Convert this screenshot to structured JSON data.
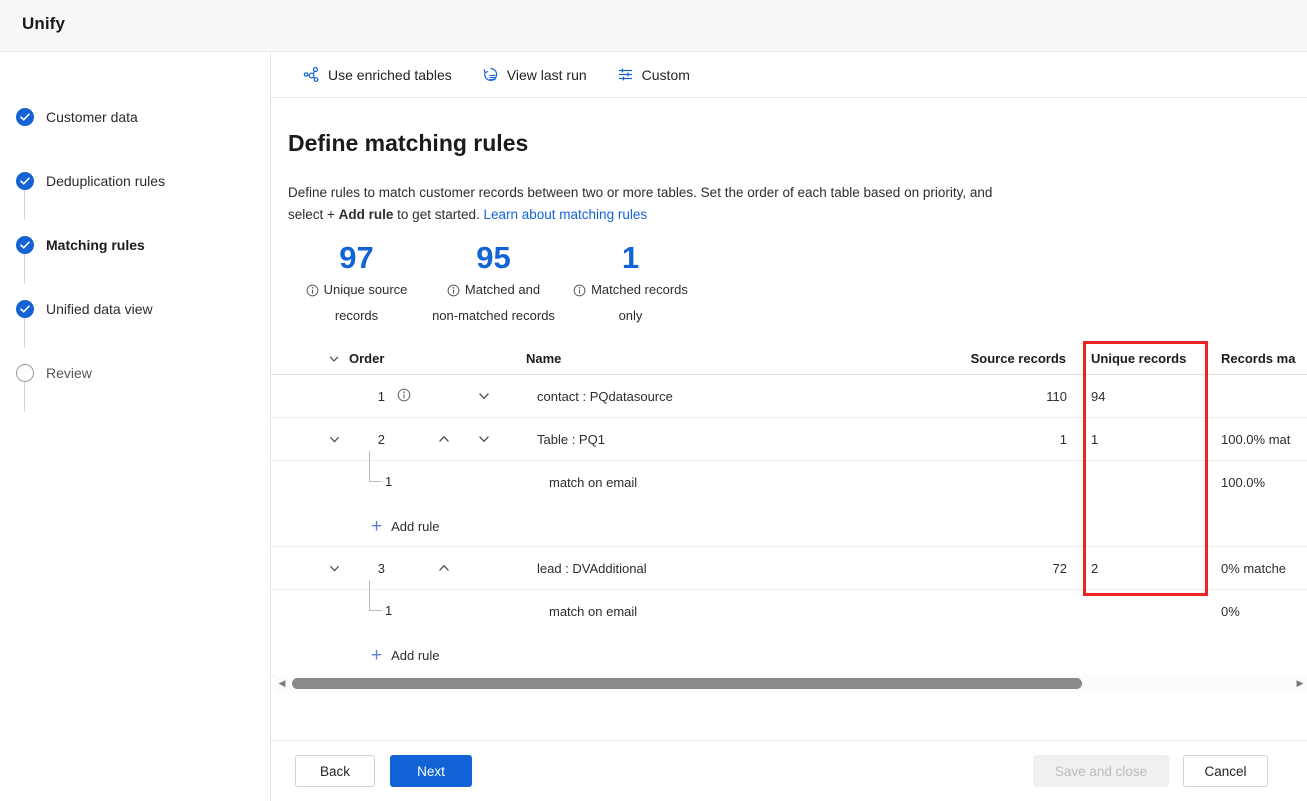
{
  "app": {
    "title": "Unify"
  },
  "sidebar": {
    "steps": [
      {
        "label": "Customer data",
        "state": "done"
      },
      {
        "label": "Deduplication rules",
        "state": "done"
      },
      {
        "label": "Matching rules",
        "state": "current"
      },
      {
        "label": "Unified data view",
        "state": "done"
      },
      {
        "label": "Review",
        "state": "todo"
      }
    ]
  },
  "commandbar": {
    "items": [
      {
        "label": "Use enriched tables",
        "icon": "graph-nodes-icon"
      },
      {
        "label": "View last run",
        "icon": "history-icon"
      },
      {
        "label": "Custom",
        "icon": "sliders-icon"
      }
    ]
  },
  "page": {
    "title": "Define matching rules",
    "description_part1": "Define rules to match customer records between two or more tables. Set the order of each table based on priority, and select + ",
    "description_bold": "Add rule",
    "description_part2": " to get started. ",
    "description_link": "Learn about matching rules"
  },
  "stats": [
    {
      "value": "97",
      "label_line1": "Unique source",
      "label_line2": "records"
    },
    {
      "value": "95",
      "label_line1": "Matched and",
      "label_line2": "non-matched records"
    },
    {
      "value": "1",
      "label_line1": "Matched records",
      "label_line2": "only"
    }
  ],
  "table": {
    "headers": {
      "order": "Order",
      "name": "Name",
      "source_records": "Source records",
      "unique_records": "Unique records",
      "records_matched": "Records ma"
    },
    "rows": [
      {
        "order": "1",
        "name": "contact : PQdatasource",
        "source_records": "110",
        "unique_records": "94",
        "records_matched": "",
        "has_info": true,
        "has_expand": false,
        "has_up": false,
        "has_down": true
      },
      {
        "order": "2",
        "name": "Table : PQ1",
        "source_records": "1",
        "unique_records": "1",
        "records_matched": "100.0% mat",
        "has_info": false,
        "has_expand": true,
        "has_up": true,
        "has_down": true
      },
      {
        "order": "3",
        "name": "lead : DVAdditional",
        "source_records": "72",
        "unique_records": "2",
        "records_matched": "0% matche",
        "has_info": false,
        "has_expand": true,
        "has_up": true,
        "has_down": false
      }
    ],
    "subrules": [
      {
        "order": "1",
        "name": "match on email",
        "records_matched": "100.0%"
      },
      {
        "order": "1",
        "name": "match on email",
        "records_matched": "0%"
      }
    ],
    "add_rule_label": "Add rule"
  },
  "footer": {
    "back": "Back",
    "next": "Next",
    "save_and_close": "Save and close",
    "cancel": "Cancel"
  },
  "colors": {
    "accent": "#1264d6",
    "annotation": "#ee2222"
  }
}
